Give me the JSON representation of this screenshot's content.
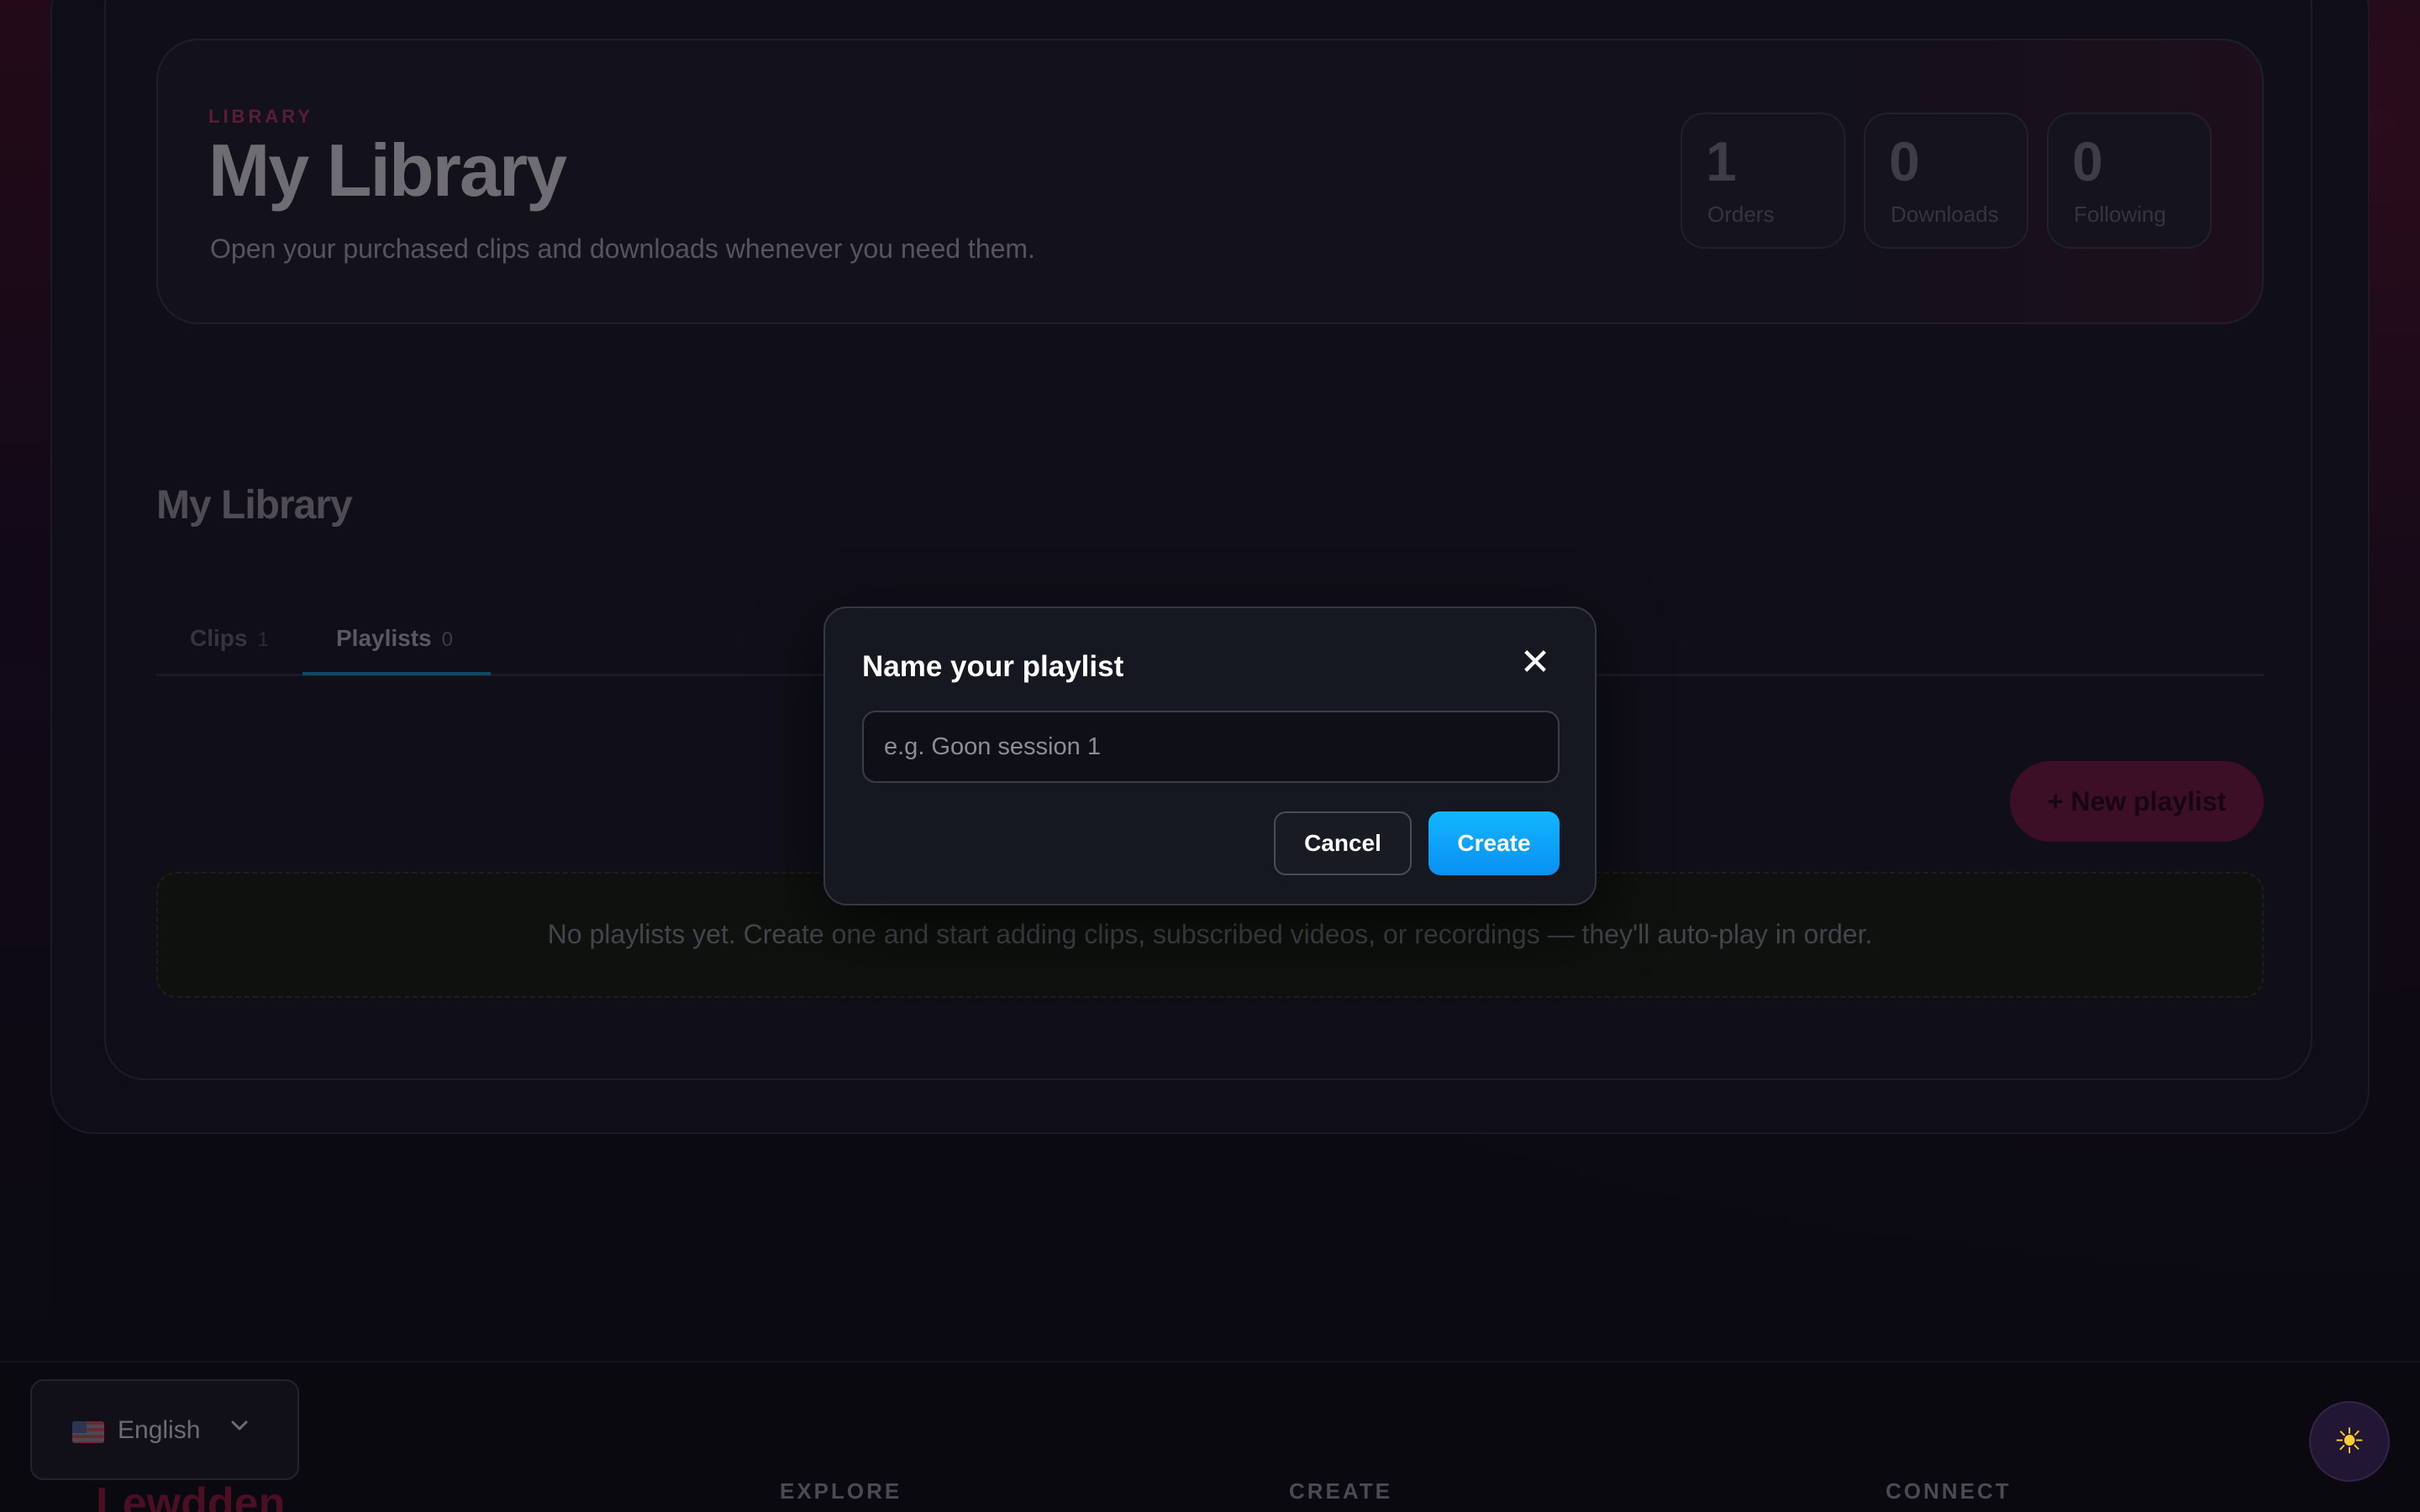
{
  "hero": {
    "eyebrow": "LIBRARY",
    "title": "My Library",
    "subtitle": "Open your purchased clips and downloads whenever you need them.",
    "stats": [
      {
        "value": "1",
        "label": "Orders"
      },
      {
        "value": "0",
        "label": "Downloads"
      },
      {
        "value": "0",
        "label": "Following"
      }
    ]
  },
  "section": {
    "title": "My Library",
    "tabs": [
      {
        "label": "Clips",
        "count": "1",
        "active": false
      },
      {
        "label": "Playlists",
        "count": "0",
        "active": true
      }
    ],
    "new_playlist_label": "+ New playlist",
    "empty_message": "No playlists yet. Create one and start adding clips, subscribed videos, or recordings — they'll auto-play in order."
  },
  "modal": {
    "title": "Name your playlist",
    "close_icon": "close-icon",
    "input_placeholder": "e.g. Goon session 1",
    "input_value": "",
    "cancel_label": "Cancel",
    "create_label": "Create"
  },
  "footer": {
    "language": "English",
    "brand": "Lewdden",
    "columns": [
      "EXPLORE",
      "CREATE",
      "CONNECT"
    ],
    "theme_icon": "sun-icon"
  },
  "colors": {
    "accent_blue": "#0fa6ff",
    "accent_pink": "#3d0f26",
    "modal_bg": "#161821"
  }
}
